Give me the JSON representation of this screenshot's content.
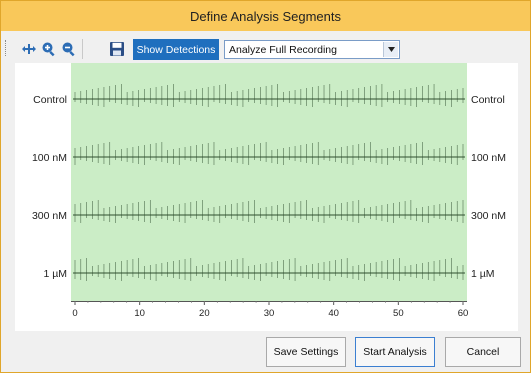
{
  "window": {
    "title": "Define Analysis Segments"
  },
  "toolbar": {
    "icons": [
      "pan-icon",
      "zoom-in-icon",
      "zoom-out-icon",
      "save-icon"
    ],
    "show_detections_label": "Show Detections",
    "analysis_select": {
      "value": "Analyze Full Recording"
    }
  },
  "plot": {
    "background_color": "#cbedc6",
    "trace_color": "#2f4f2f",
    "channels": [
      {
        "left_label": "Control",
        "right_label": "Control"
      },
      {
        "left_label": "100 nM",
        "right_label": "100 nM"
      },
      {
        "left_label": "300 nM",
        "right_label": "300 nM"
      },
      {
        "left_label": "1 µM",
        "right_label": "1 µM"
      }
    ],
    "x_ticks": [
      "0",
      "10",
      "20",
      "30",
      "40",
      "50",
      "60"
    ],
    "x_range": [
      0,
      60
    ]
  },
  "buttons": {
    "save_settings": "Save Settings",
    "start_analysis": "Start Analysis",
    "cancel": "Cancel"
  },
  "colors": {
    "title_bar": "#f9c85a",
    "window_border": "#e0a62b",
    "accent_button": "#1f6fbe"
  }
}
